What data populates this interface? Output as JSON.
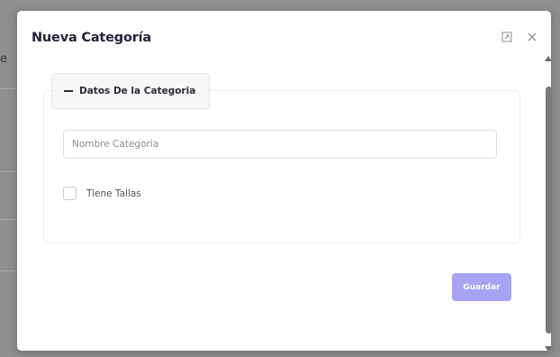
{
  "modal": {
    "title": "Nueva Categoría",
    "maximize_icon": "maximize-icon",
    "close_icon": "close-icon"
  },
  "fieldset": {
    "legend": "Datos De la Categoria",
    "legend_icon": "minus-icon"
  },
  "form": {
    "name_placeholder": "Nombre Categoria",
    "name_value": "",
    "sizes_checkbox_label": "Tiene Tallas",
    "sizes_checked": false
  },
  "actions": {
    "save_label": "Guardar"
  },
  "colors": {
    "accent_button": "#a7a4f5",
    "title_text": "#23233a"
  }
}
